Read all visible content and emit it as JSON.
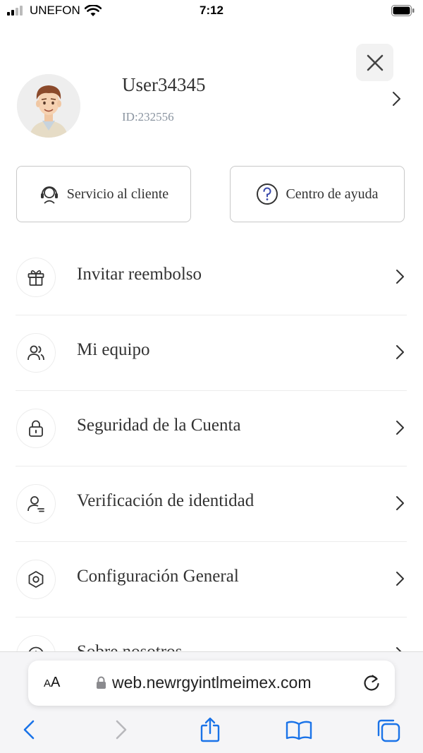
{
  "status_bar": {
    "carrier": "UNEFON",
    "time": "7:12"
  },
  "profile": {
    "username": "User34345",
    "id_text": "ID:232556"
  },
  "quick_actions": [
    {
      "label": "Servicio al cliente",
      "icon": "headset-icon"
    },
    {
      "label": "Centro de ayuda",
      "icon": "question-circle-icon"
    }
  ],
  "menu": [
    {
      "label": "Invitar reembolso",
      "icon": "gift-icon"
    },
    {
      "label": "Mi equipo",
      "icon": "users-icon"
    },
    {
      "label": "Seguridad de la Cuenta",
      "icon": "lock-icon"
    },
    {
      "label": "Verificación de identidad",
      "icon": "user-id-icon"
    },
    {
      "label": "Configuración General",
      "icon": "hexagon-settings-icon"
    },
    {
      "label": "Sobre nosotros",
      "icon": "info-icon"
    }
  ],
  "browser": {
    "aa_label_small": "A",
    "aa_label_big": "A",
    "url": "web.newrgyintlmeimex.com"
  },
  "colors": {
    "text": "#333333",
    "muted": "#8a94a0",
    "ios_blue": "#1a73e8",
    "border": "#c8c8c8"
  }
}
